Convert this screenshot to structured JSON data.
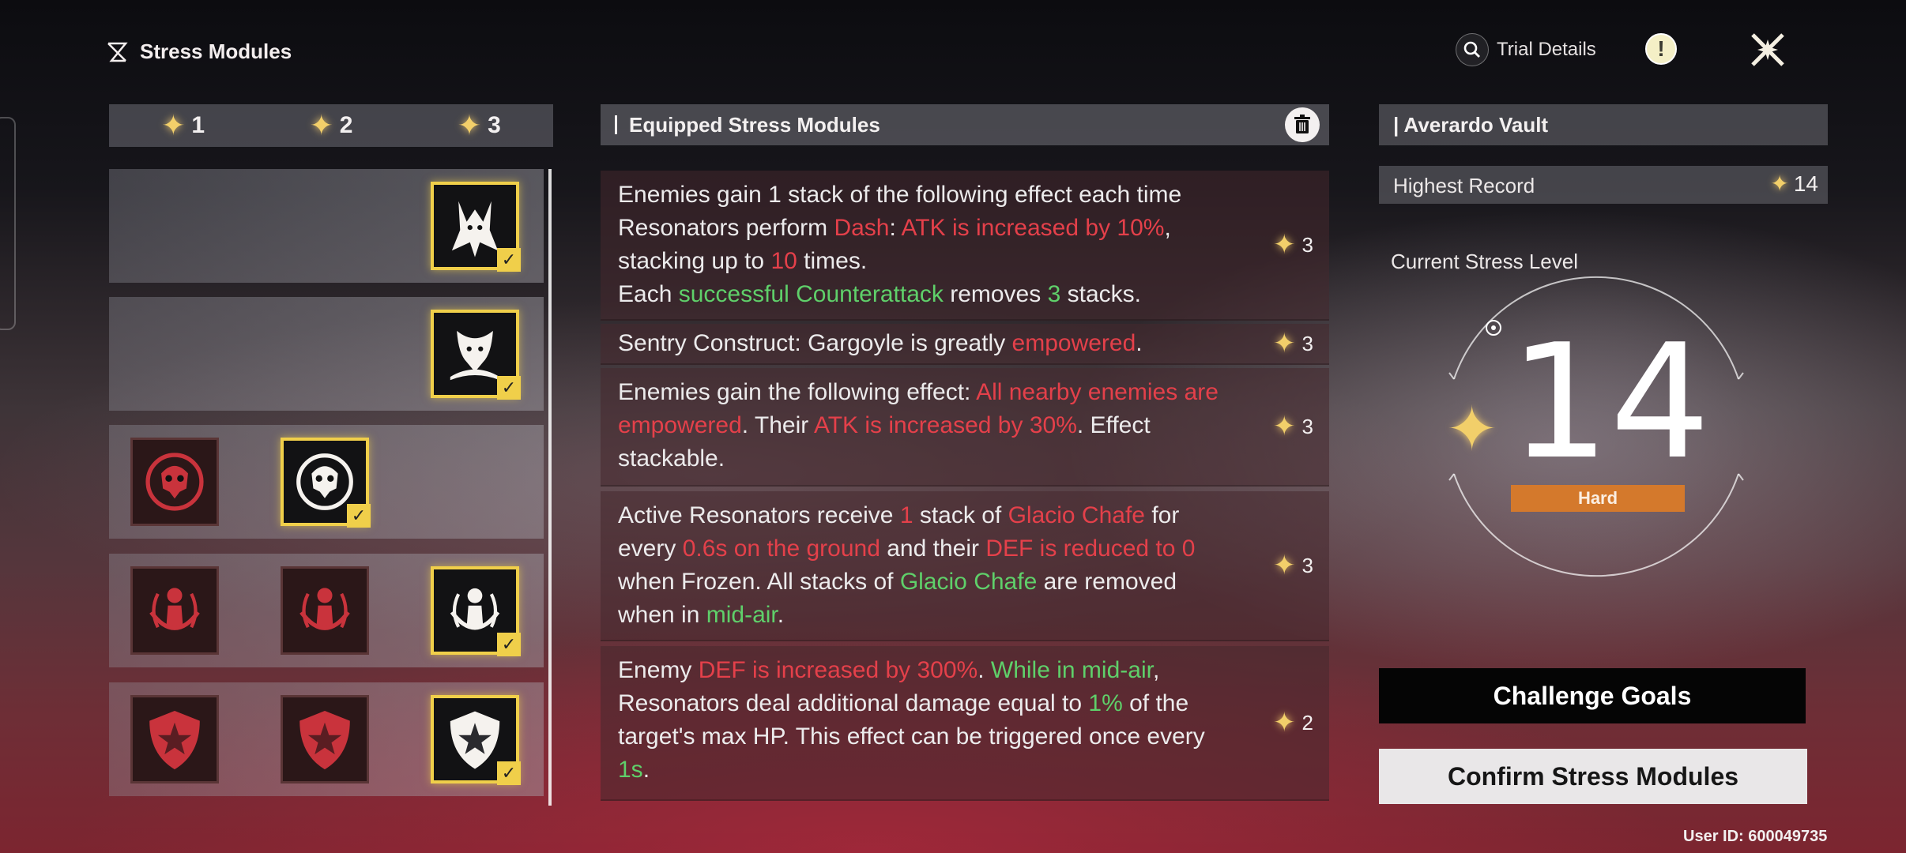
{
  "header": {
    "title": "Stress Modules",
    "trial_details": "Trial Details",
    "alert_glyph": "!"
  },
  "filters": [
    {
      "value": "1"
    },
    {
      "value": "2"
    },
    {
      "value": "3"
    }
  ],
  "equipped": {
    "title": "Equipped Stress Modules",
    "items": [
      {
        "cost": "3",
        "segments": [
          {
            "t": "Enemies gain 1 stack of the following effect each time Resonators perform ",
            "c": "n"
          },
          {
            "t": "Dash",
            "c": "r"
          },
          {
            "t": ": ",
            "c": "n"
          },
          {
            "t": "ATK is increased by 10%",
            "c": "r"
          },
          {
            "t": ", stacking up to ",
            "c": "n"
          },
          {
            "t": "10",
            "c": "r"
          },
          {
            "t": " times.",
            "c": "n"
          },
          {
            "t": "\n",
            "c": "br"
          },
          {
            "t": "Each ",
            "c": "n"
          },
          {
            "t": "successful Counterattack",
            "c": "g"
          },
          {
            "t": " removes ",
            "c": "n"
          },
          {
            "t": "3",
            "c": "g"
          },
          {
            "t": " stacks.",
            "c": "n"
          }
        ]
      },
      {
        "cost": "3",
        "segments": [
          {
            "t": "Sentry Construct: Gargoyle is greatly ",
            "c": "n"
          },
          {
            "t": "empowered",
            "c": "r"
          },
          {
            "t": ".",
            "c": "n"
          }
        ]
      },
      {
        "cost": "3",
        "segments": [
          {
            "t": "Enemies gain the following effect: ",
            "c": "n"
          },
          {
            "t": "All nearby enemies are empowered",
            "c": "r"
          },
          {
            "t": ". Their ",
            "c": "n"
          },
          {
            "t": "ATK is increased by 30%",
            "c": "r"
          },
          {
            "t": ". Effect stackable.",
            "c": "n"
          }
        ]
      },
      {
        "cost": "3",
        "segments": [
          {
            "t": "Active Resonators receive ",
            "c": "n"
          },
          {
            "t": "1",
            "c": "r"
          },
          {
            "t": " stack of ",
            "c": "n"
          },
          {
            "t": "Glacio Chafe",
            "c": "r"
          },
          {
            "t": " for every ",
            "c": "n"
          },
          {
            "t": "0.6s on the ground",
            "c": "r"
          },
          {
            "t": " and their ",
            "c": "n"
          },
          {
            "t": "DEF is reduced to 0",
            "c": "r"
          },
          {
            "t": " when Frozen. All stacks of ",
            "c": "n"
          },
          {
            "t": "Glacio Chafe",
            "c": "g"
          },
          {
            "t": " are removed when in ",
            "c": "n"
          },
          {
            "t": "mid-air",
            "c": "g"
          },
          {
            "t": ".",
            "c": "n"
          }
        ]
      },
      {
        "cost": "2",
        "segments": [
          {
            "t": "Enemy ",
            "c": "n"
          },
          {
            "t": "DEF is increased by 300%",
            "c": "r"
          },
          {
            "t": ". ",
            "c": "n"
          },
          {
            "t": "While in mid-air",
            "c": "g"
          },
          {
            "t": ", Resonators deal additional damage equal to ",
            "c": "n"
          },
          {
            "t": "1%",
            "c": "g"
          },
          {
            "t": " of the target's max HP. This effect can be triggered once every ",
            "c": "n"
          },
          {
            "t": "1s",
            "c": "g"
          },
          {
            "t": ".",
            "c": "n"
          }
        ]
      }
    ]
  },
  "vault": {
    "title": "| Averardo Vault",
    "highest_record_label": "Highest Record",
    "highest_record_value": "14",
    "stress_label": "Current Stress Level",
    "stress_value": "14",
    "difficulty": "Hard"
  },
  "buttons": {
    "goals": "Challenge Goals",
    "confirm": "Confirm Stress Modules"
  },
  "user_id": "User ID: 600049735",
  "modules": [
    {
      "tier": "3",
      "icons": [
        {
          "name": "horned-demon-icon",
          "state": "selected"
        }
      ]
    },
    {
      "tier": "3",
      "icons": [
        {
          "name": "gargoyle-icon",
          "state": "selected"
        }
      ]
    },
    {
      "tier": "2",
      "icons": [
        {
          "name": "skull-emblem-icon",
          "state": "locked"
        },
        {
          "name": "skull-emblem-icon",
          "state": "selected"
        }
      ]
    },
    {
      "tier": "3",
      "icons": [
        {
          "name": "glacio-figure-icon",
          "state": "locked"
        },
        {
          "name": "glacio-figure-icon",
          "state": "locked"
        },
        {
          "name": "glacio-figure-icon",
          "state": "selected"
        }
      ]
    },
    {
      "tier": "3",
      "icons": [
        {
          "name": "shield-star-icon",
          "state": "locked"
        },
        {
          "name": "shield-star-icon",
          "state": "locked"
        },
        {
          "name": "shield-star-icon",
          "state": "selected"
        }
      ]
    }
  ],
  "colors": {
    "accent_gold": "#f0cf4a",
    "danger_red": "#e4404a",
    "buff_green": "#5fd06a",
    "difficulty_orange": "#d4792c"
  }
}
